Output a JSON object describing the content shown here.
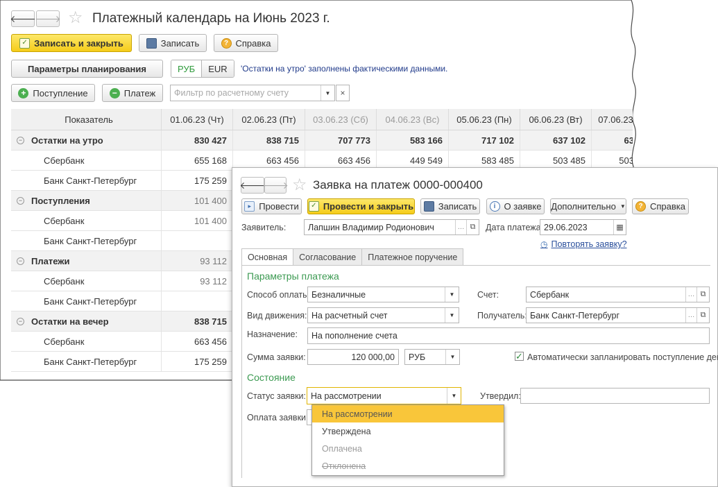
{
  "calendar": {
    "title": "Платежный календарь на Июнь 2023 г.",
    "nav_back": "🡐",
    "nav_forward": "🡒",
    "star": "☆",
    "btn_save_close": "Записать и закрыть",
    "btn_save": "Записать",
    "btn_help": "Справка",
    "btn_planning": "Параметры планирования",
    "currency_rub": "РУБ",
    "currency_eur": "EUR",
    "note": "'Остатки на утро' заполнены фактическими данными.",
    "btn_income": "Поступление",
    "btn_payment": "Платеж",
    "filter_placeholder": "Фильтр по расчетному счету",
    "filter_clear": "×",
    "columns": [
      "Показатель",
      "01.06.23 (Чт)",
      "02.06.23 (Пт)",
      "03.06.23 (Сб)",
      "04.06.23 (Вс)",
      "05.06.23 (Пн)",
      "06.06.23 (Вт)",
      "07.06.23"
    ],
    "weekend_columns": [
      3,
      4
    ],
    "rows": [
      {
        "label": "Остатки на утро",
        "group": true,
        "values": [
          "830 427",
          "838 715",
          "707 773",
          "583 166",
          "717 102",
          "637 102",
          "63"
        ]
      },
      {
        "label": "Сбербанк",
        "group": false,
        "values": [
          "655 168",
          "663 456",
          "663 456",
          "449 549",
          "583 485",
          "503 485",
          "503"
        ]
      },
      {
        "label": "Банк Санкт-Петербург",
        "group": false,
        "values": [
          "175 259",
          "",
          "",
          "",
          "",
          "",
          ""
        ]
      },
      {
        "label": "Поступления",
        "group": true,
        "muted": true,
        "values": [
          "101 400",
          "",
          "",
          "",
          "",
          "",
          ""
        ]
      },
      {
        "label": "Сбербанк",
        "group": false,
        "muted": true,
        "values": [
          "101 400",
          "",
          "",
          "",
          "",
          "",
          ""
        ]
      },
      {
        "label": "Банк Санкт-Петербург",
        "group": false,
        "values": [
          "",
          "",
          "",
          "",
          "",
          "",
          ""
        ]
      },
      {
        "label": "Платежи",
        "group": true,
        "muted": true,
        "values": [
          "93 112",
          "",
          "",
          "",
          "",
          "",
          ""
        ]
      },
      {
        "label": "Сбербанк",
        "group": false,
        "muted": true,
        "values": [
          "93 112",
          "",
          "",
          "",
          "",
          "",
          ""
        ]
      },
      {
        "label": "Банк Санкт-Петербург",
        "group": false,
        "values": [
          "",
          "",
          "",
          "",
          "",
          "",
          ""
        ]
      },
      {
        "label": "Остатки на вечер",
        "group": true,
        "values": [
          "838 715",
          "",
          "",
          "",
          "",
          "",
          ""
        ]
      },
      {
        "label": "Сбербанк",
        "group": false,
        "values": [
          "663 456",
          "",
          "",
          "",
          "",
          "",
          ""
        ]
      },
      {
        "label": "Банк Санкт-Петербург",
        "group": false,
        "values": [
          "175 259",
          "",
          "",
          "",
          "",
          "",
          ""
        ]
      }
    ]
  },
  "request": {
    "title": "Заявка на платеж 0000-000400",
    "btn_post": "Провести",
    "btn_post_close": "Провести и закрыть",
    "btn_save": "Записать",
    "btn_about": "О заявке",
    "btn_more": "Дополнительно",
    "btn_help": "Справка",
    "applicant_label": "Заявитель:",
    "applicant_value": "Лапшин Владимир Родионович",
    "date_label": "Дата платежа:",
    "date_value": "29.06.2023",
    "repeat_link": "Повторять заявку?",
    "tabs": [
      "Основная",
      "Согласование",
      "Платежное поручение"
    ],
    "section_params": "Параметры платежа",
    "pay_method_label": "Способ оплаты:",
    "pay_method_value": "Безналичные",
    "account_label": "Счет:",
    "account_value": "Сбербанк",
    "movement_label": "Вид движения:",
    "movement_value": "На расчетный счет",
    "recipient_label": "Получатель:",
    "recipient_value": "Банк Санкт-Петербург",
    "purpose_label": "Назначение:",
    "purpose_value": "На пополнение счета",
    "amount_label": "Сумма заявки:",
    "amount_value": "120 000,00",
    "amount_currency": "РУБ",
    "auto_plan_label": "Автоматически запланировать поступление денег",
    "auto_plan_checked": true,
    "section_state": "Состояние",
    "status_label": "Статус заявки:",
    "status_value": "На рассмотрении",
    "approver_label": "Утвердил:",
    "approver_value": "",
    "payment_label": "Оплата заявки:",
    "status_options": [
      {
        "label": "На рассмотрении",
        "state": "selected"
      },
      {
        "label": "Утверждена",
        "state": "normal"
      },
      {
        "label": "Оплачена",
        "state": "disabled"
      },
      {
        "label": "Отклонена",
        "state": "strike"
      }
    ]
  }
}
